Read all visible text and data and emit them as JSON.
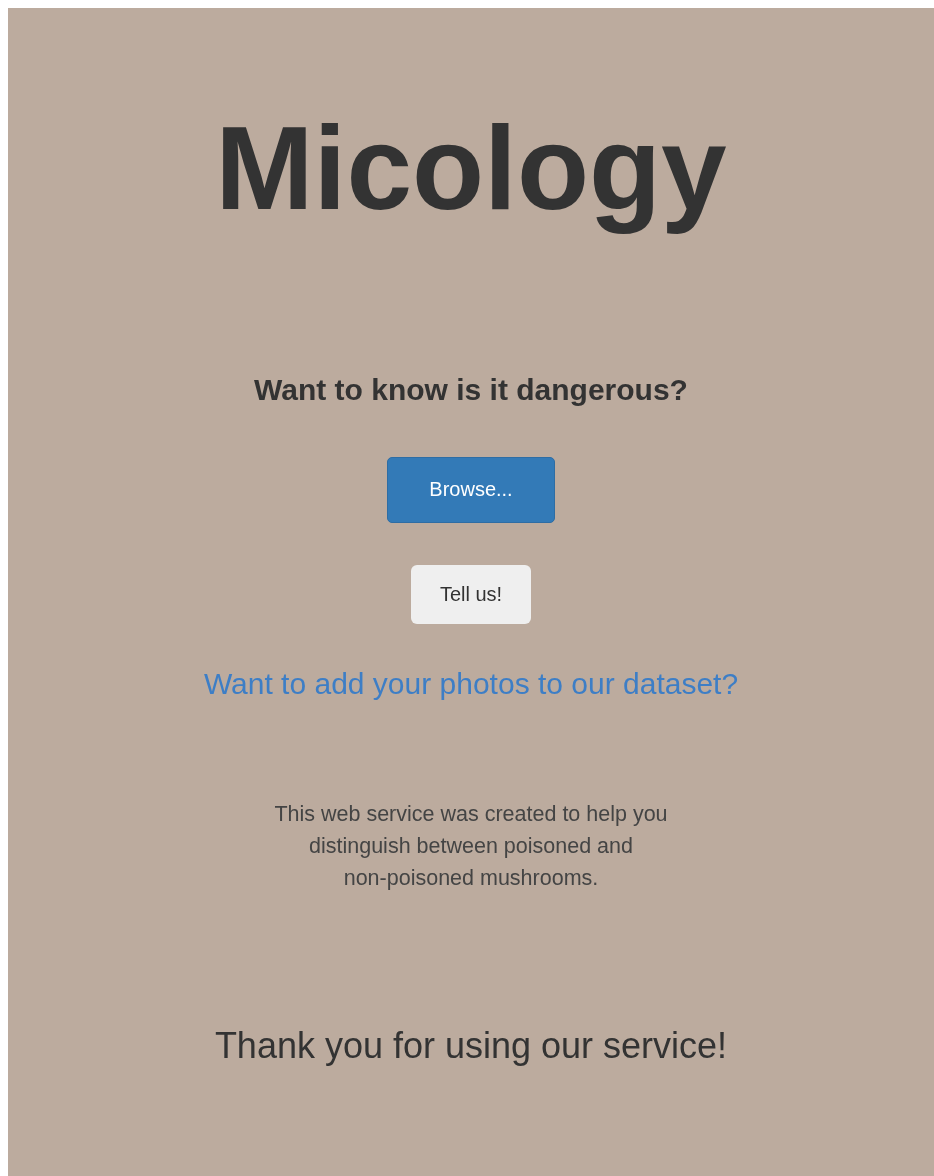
{
  "title": "Micology",
  "heading": "Want to know is it dangerous?",
  "browse_button": "Browse...",
  "submit_button": "Tell us!",
  "dataset_link": "Want to add your photos to our dataset?",
  "description_lines": [
    "This web service was created to help you",
    "distinguish between poisoned and",
    "non-poisoned mushrooms."
  ],
  "thanks": "Thank you for using our service!"
}
